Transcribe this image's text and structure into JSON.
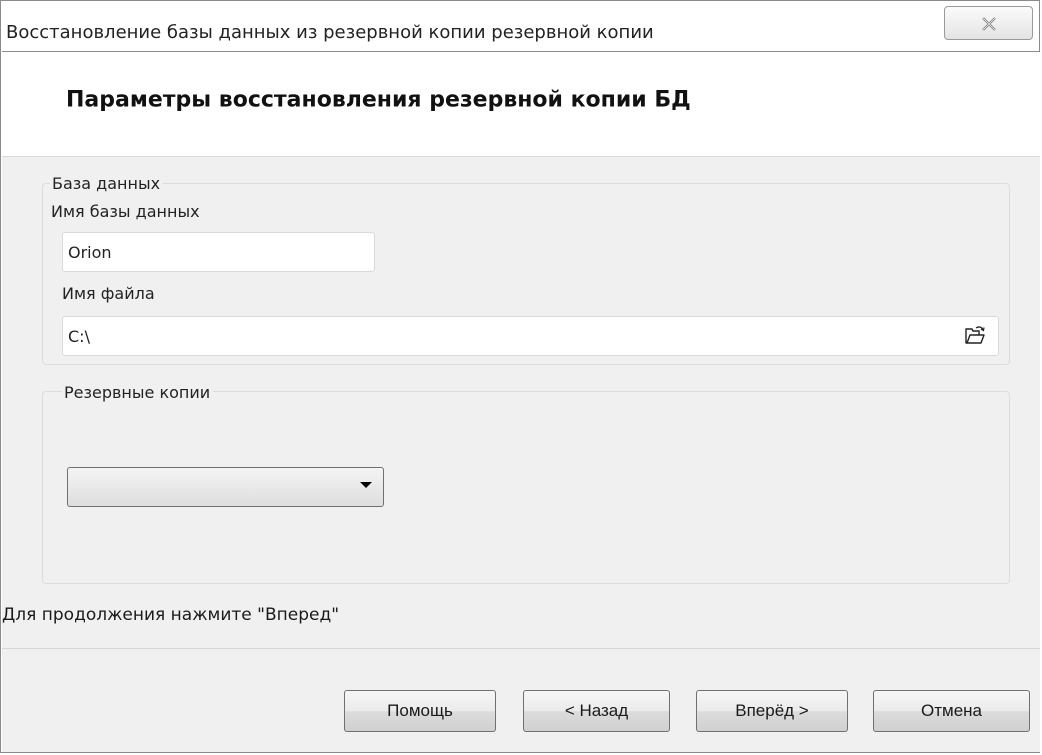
{
  "window": {
    "title": "Восстановление базы данных из резервной копии резервной копии",
    "close_icon": "close-icon"
  },
  "header": {
    "title": "Параметры восстановления резервной копии БД"
  },
  "database_group": {
    "legend": "База данных",
    "db_name_label": "Имя базы данных",
    "db_name_value": "Orion",
    "file_name_label": "Имя файла",
    "file_name_value": "C:\\",
    "browse_icon": "open-folder-icon"
  },
  "backups_group": {
    "legend": "Резервные копии",
    "selected": ""
  },
  "hint": "Для продолжения нажмите \"Вперед\"",
  "buttons": {
    "help": "Помощь",
    "back": "< Назад",
    "next": "Вперёд >",
    "cancel": "Отмена"
  }
}
